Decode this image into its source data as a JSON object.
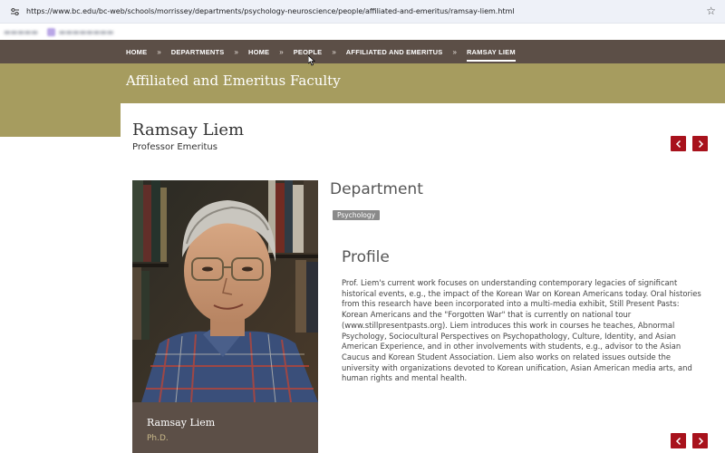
{
  "browser": {
    "url": "https://www.bc.edu/bc-web/schools/morrissey/departments/psychology-neuroscience/people/affiliated-and-emeritus/ramsay-liem.html"
  },
  "breadcrumb": {
    "items": [
      "HOME",
      "DEPARTMENTS",
      "HOME",
      "PEOPLE",
      "AFFILIATED AND EMERITUS",
      "RAMSAY LIEM"
    ],
    "separator": "»"
  },
  "banner": {
    "title": "Affiliated and Emeritus Faculty"
  },
  "person": {
    "name": "Ramsay Liem",
    "title": "Professor Emeritus",
    "caption_name": "Ramsay Liem",
    "degree": "Ph.D."
  },
  "department": {
    "heading": "Department",
    "tag": "Psychology"
  },
  "profile": {
    "heading": "Profile",
    "text": "Prof. Liem's current work focuses on understanding contemporary legacies of significant historical events, e.g., the impact of the Korean War on Korean Americans today. Oral histories from this research have been incorporated into a multi-media exhibit, Still Present Pasts: Korean Americans and the \"Forgotten War\" that is currently on national tour (www.stillpresentpasts.org). Liem introduces this work in courses he teaches, Abnormal Psychology, Sociocultural Perspectives on Psychopathology, Culture, Identity, and Asian American Experience, and in other involvements with students, e.g., advisor to the Asian Caucus and Korean Student Association. Liem also works on related issues outside the university with organizations devoted to Korean unification, Asian American media arts, and human rights and mental health."
  },
  "colors": {
    "nav_brown": "#5c4f47",
    "banner_gold": "#a69c5f",
    "accent_red": "#a8121c",
    "tag_gray": "#8a8a8a"
  },
  "icons": {
    "prev": "chevron-left-icon",
    "next": "chevron-right-icon",
    "bookmark": "star-icon",
    "site_info": "tune-icon"
  }
}
